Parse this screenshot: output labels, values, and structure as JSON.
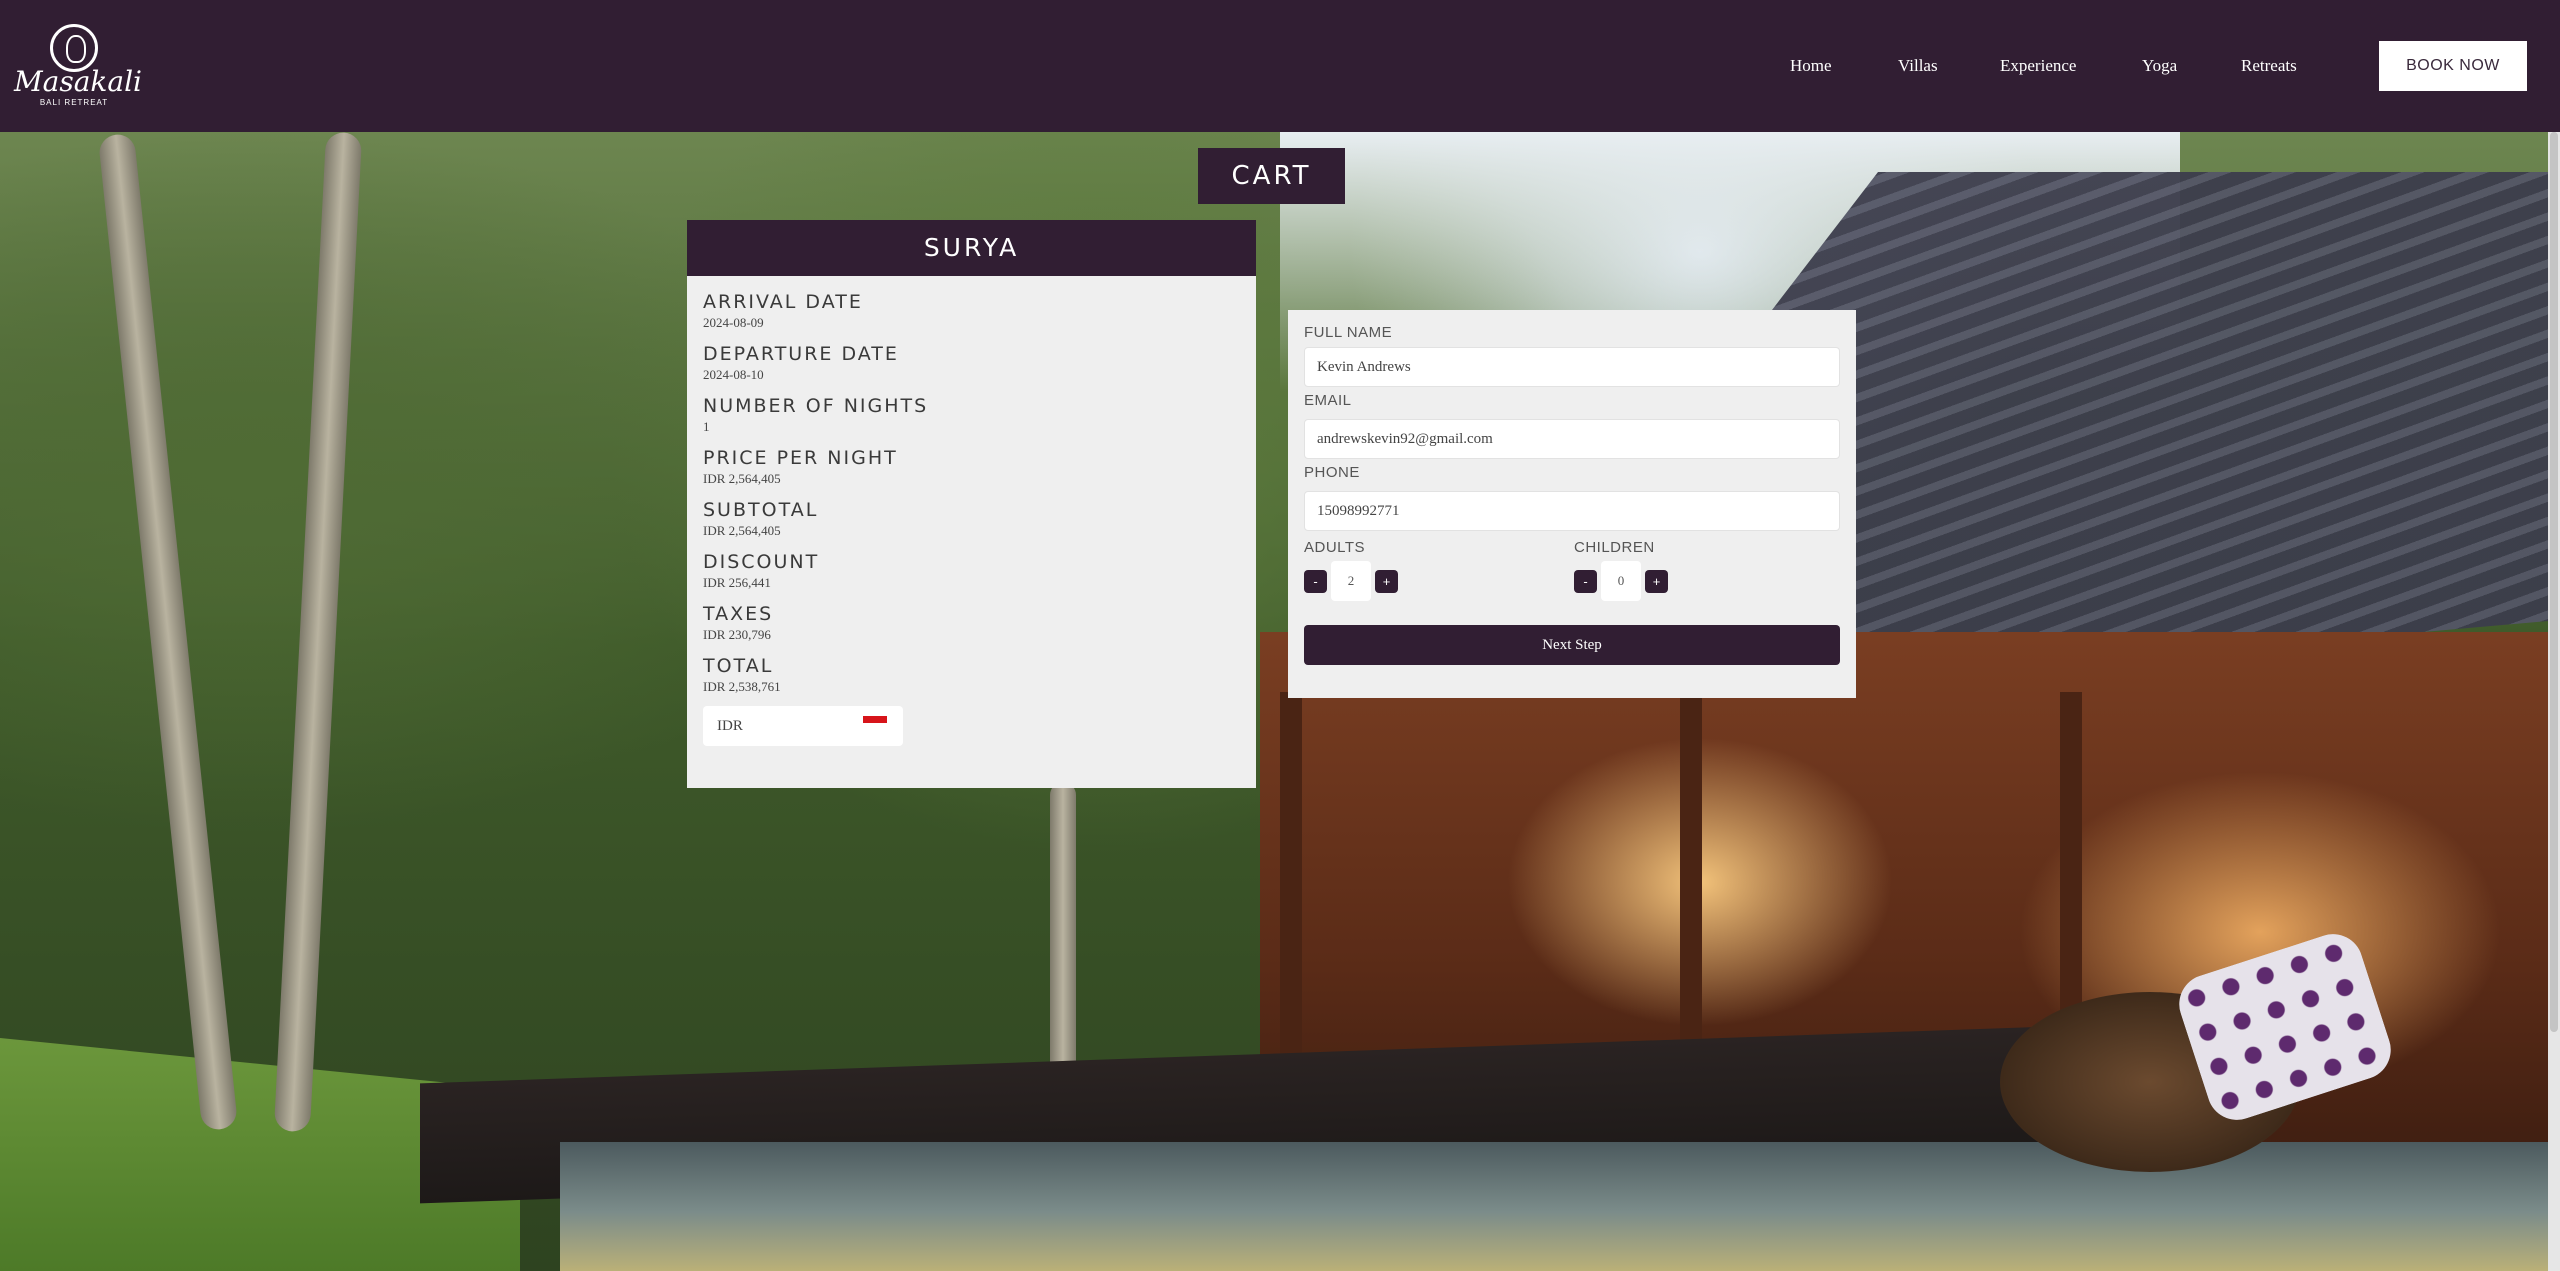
{
  "brand": {
    "name": "Masakali",
    "tagline": "BALI RETREAT"
  },
  "nav": {
    "items": [
      {
        "label": "Home"
      },
      {
        "label": "Villas"
      },
      {
        "label": "Experience"
      },
      {
        "label": "Yoga"
      },
      {
        "label": "Retreats"
      }
    ],
    "book_now": "BOOK NOW"
  },
  "cart": {
    "title": "CART"
  },
  "summary": {
    "villa": "SURYA",
    "rows": [
      {
        "label": "ARRIVAL DATE",
        "value": "2024-08-09"
      },
      {
        "label": "DEPARTURE DATE",
        "value": "2024-08-10"
      },
      {
        "label": "NUMBER OF NIGHTS",
        "value": "1"
      },
      {
        "label": "PRICE PER NIGHT",
        "value": "IDR 2,564,405"
      },
      {
        "label": "SUBTOTAL",
        "value": "IDR 2,564,405"
      },
      {
        "label": "DISCOUNT",
        "value": "IDR 256,441"
      },
      {
        "label": "TAXES",
        "value": "IDR 230,796"
      },
      {
        "label": "TOTAL",
        "value": "IDR 2,538,761"
      }
    ],
    "currency": "IDR"
  },
  "form": {
    "full_name": {
      "label": "FULL NAME",
      "value": "Kevin Andrews"
    },
    "email": {
      "label": "EMAIL",
      "value": "andrewskevin92@gmail.com"
    },
    "phone": {
      "label": "PHONE",
      "value": "15098992771"
    },
    "adults": {
      "label": "ADULTS",
      "value": "2",
      "minus": "-",
      "plus": "+"
    },
    "children": {
      "label": "CHILDREN",
      "value": "0",
      "minus": "-",
      "plus": "+"
    },
    "next": "Next Step"
  },
  "colors": {
    "brand": "#311e33",
    "panel": "#efefef",
    "flag_red": "#d7141a"
  },
  "icons": {
    "logo": "masakali-logo-icon",
    "flag": "indonesia-flag-icon"
  }
}
